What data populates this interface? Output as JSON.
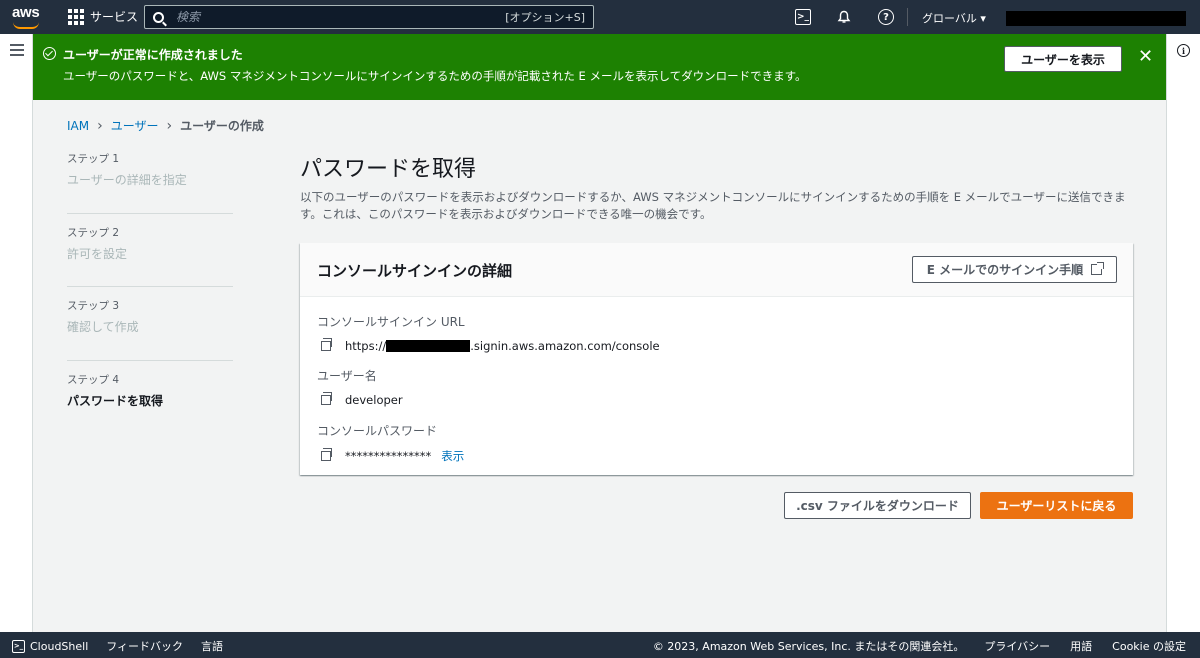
{
  "topnav": {
    "logo": "aws",
    "services_label": "サービス",
    "search_placeholder": "検索",
    "search_shortcut": "[オプション+S]",
    "cloudshell_icon": "terminal-icon",
    "notifications_icon": "bell-icon",
    "help_icon": "help-icon",
    "region_label": "グローバル ▾"
  },
  "flash": {
    "title": "ユーザーが正常に作成されました",
    "message": "ユーザーのパスワードと、AWS マネジメントコンソールにサインインするための手順が記載された E メールを表示してダウンロードできます。",
    "view_button": "ユーザーを表示",
    "color": "#1d8102"
  },
  "breadcrumb": {
    "items": [
      "IAM",
      "ユーザー",
      "ユーザーの作成"
    ]
  },
  "steps": [
    {
      "label": "ステップ 1",
      "desc": "ユーザーの詳細を指定"
    },
    {
      "label": "ステップ 2",
      "desc": "許可を設定"
    },
    {
      "label": "ステップ 3",
      "desc": "確認して作成"
    },
    {
      "label": "ステップ 4",
      "desc": "パスワードを取得"
    }
  ],
  "main": {
    "title": "パスワードを取得",
    "description": "以下のユーザーのパスワードを表示およびダウンロードするか、AWS マネジメントコンソールにサインインするための手順を E メールでユーザーに送信できます。これは、このパスワードを表示およびダウンロードできる唯一の機会です。"
  },
  "panel": {
    "title": "コンソールサインインの詳細",
    "email_button": "E メールでのサインイン手順",
    "url_label": "コンソールサインイン URL",
    "url_prefix": "https://",
    "url_suffix": ".signin.aws.amazon.com/console",
    "username_label": "ユーザー名",
    "username": "developer",
    "password_label": "コンソールパスワード",
    "password_masked": "***************",
    "show_link": "表示"
  },
  "actions": {
    "download_csv": ".csv ファイルをダウンロード",
    "return_to_users": "ユーザーリストに戻る",
    "primary_color": "#ec7211"
  },
  "footer": {
    "cloudshell": "CloudShell",
    "feedback": "フィードバック",
    "language": "言語",
    "copyright": "© 2023, Amazon Web Services, Inc. またはその関連会社。",
    "privacy": "プライバシー",
    "terms": "用語",
    "cookie": "Cookie の設定"
  }
}
